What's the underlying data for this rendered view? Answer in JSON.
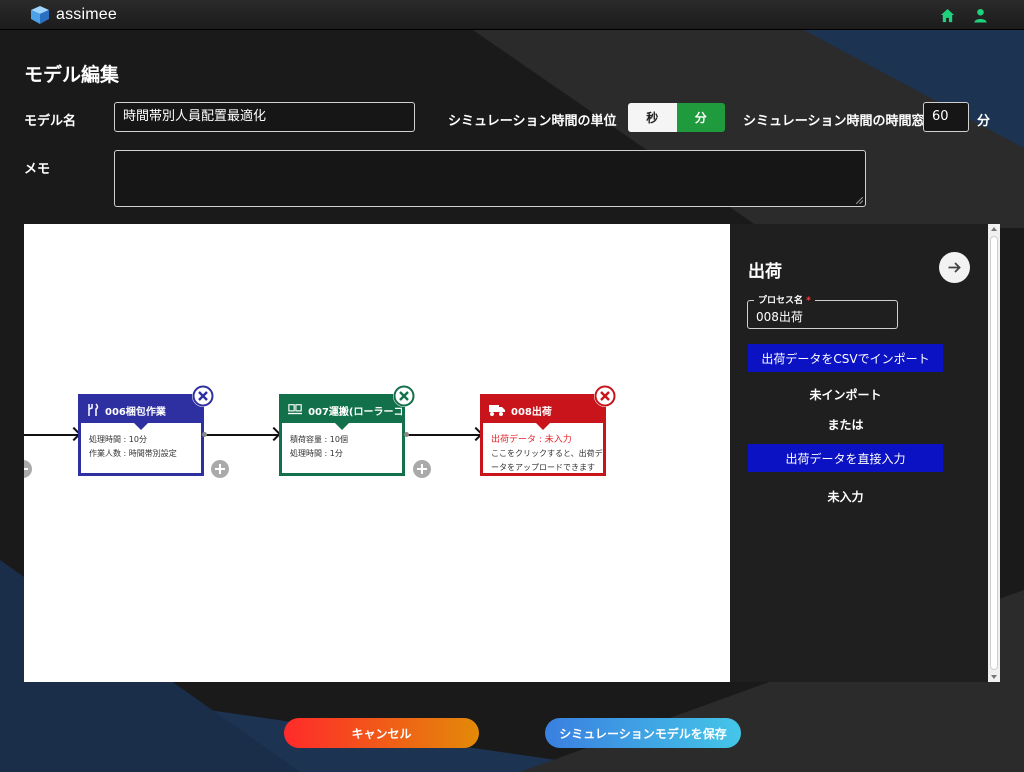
{
  "app": {
    "name": "assimee"
  },
  "header": {
    "home_icon": "home-icon",
    "user_icon": "user-icon",
    "accent": "#1fd17c"
  },
  "page": {
    "title": "モデル編集"
  },
  "form": {
    "model_name_label": "モデル名",
    "model_name_value": "時間帯別人員配置最適化",
    "unit_label": "シミュレーション時間の単位",
    "unit_options": [
      "秒",
      "分"
    ],
    "unit_selected": "分",
    "window_label": "シミュレーション時間の時間窓",
    "window_value": "60",
    "window_unit": "分",
    "memo_label": "メモ",
    "memo_value": ""
  },
  "flow": {
    "nodes": [
      {
        "title": "006梱包作業",
        "icon": "tools-icon",
        "lines": [
          "処理時間 : 10分",
          "作業人数 : 時間帯別設定"
        ],
        "color": "#2e2fa0"
      },
      {
        "title": "007運搬(ローラーコ...",
        "icon": "conveyor-icon",
        "lines": [
          "積荷容量 : 10個",
          "処理時間 : 1分"
        ],
        "color": "#12704a"
      },
      {
        "title": "008出荷",
        "icon": "truck-icon",
        "warning": "出荷データ : 未入力",
        "lines": [
          "ここをクリックすると、出荷デ",
          "ータをアップロードできます"
        ],
        "color": "#c8141a"
      }
    ]
  },
  "panel": {
    "title": "出荷",
    "field_label": "プロセス名",
    "field_required_mark": "*",
    "field_value": "008出荷",
    "import_button": "出荷データをCSVでインポート",
    "import_status": "未インポート",
    "or_text": "または",
    "direct_button": "出荷データを直接入力",
    "direct_status": "未入力",
    "button_color": "#0b12c4"
  },
  "footer": {
    "cancel_label": "キャンセル",
    "save_label": "シミュレーションモデルを保存"
  }
}
